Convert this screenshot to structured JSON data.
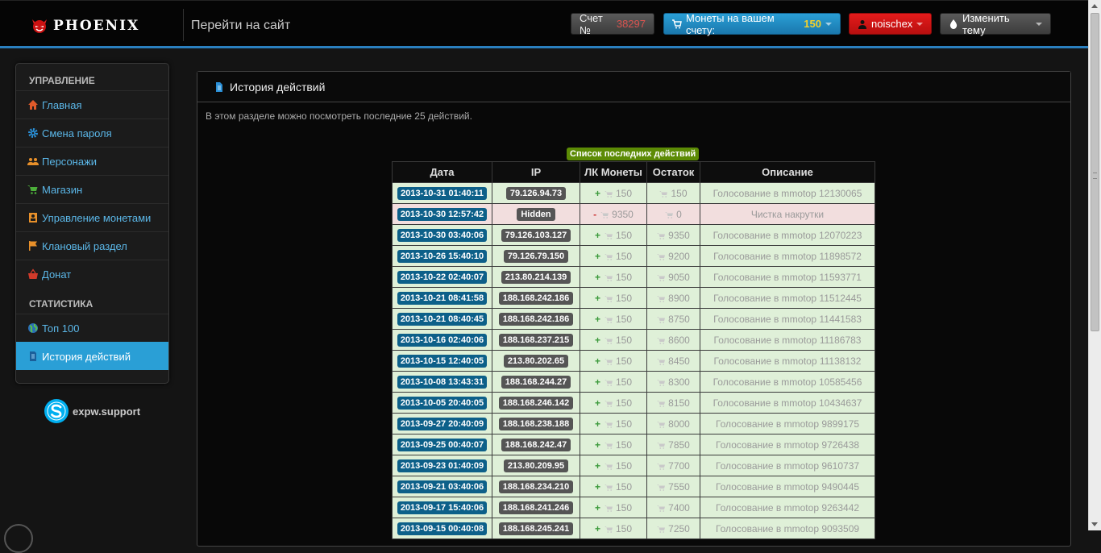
{
  "header": {
    "brand": "PHOENIX",
    "goto_site": "Перейти на сайт",
    "account_label": "Счет №",
    "account_number": "38297",
    "coins_label": "Монеты на вашем счету:",
    "coins_value": "150",
    "username": "noischex",
    "theme_label": "Изменить тему"
  },
  "sidebar": {
    "section_manage": "УПРАВЛЕНИЕ",
    "items": [
      {
        "label": "Главная",
        "icon": "home-icon"
      },
      {
        "label": "Смена пароля",
        "icon": "gear-icon"
      },
      {
        "label": "Персонажи",
        "icon": "users-icon"
      },
      {
        "label": "Магазин",
        "icon": "cart-icon"
      },
      {
        "label": "Управление монетами",
        "icon": "coins-icon"
      },
      {
        "label": "Клановый раздел",
        "icon": "flag-icon"
      },
      {
        "label": "Донат",
        "icon": "basket-icon"
      }
    ],
    "section_stats": "СТАТИСТИКА",
    "stats_items": [
      {
        "label": "Топ 100",
        "icon": "globe-icon"
      },
      {
        "label": "История действий",
        "icon": "document-icon",
        "active": true
      }
    ],
    "skype": "expw.support"
  },
  "panel": {
    "title": "История действий",
    "description": "В этом разделе можно посмотреть последние 25 действий."
  },
  "table": {
    "caption": "Список последних действий",
    "headers": [
      "Дата",
      "IP",
      "ЛК Монеты",
      "Остаток",
      "Описание"
    ],
    "rows": [
      {
        "date": "2013-10-31 01:40:11",
        "ip": "79.126.94.73",
        "sign": "+",
        "amount": "150",
        "balance": "150",
        "desc": "Голосование в mmotop 12130065",
        "type": "plus"
      },
      {
        "date": "2013-10-30 12:57:42",
        "ip": "Hidden",
        "sign": "-",
        "amount": "9350",
        "balance": "0",
        "desc": "Чистка накрутки",
        "type": "minus"
      },
      {
        "date": "2013-10-30 03:40:06",
        "ip": "79.126.103.127",
        "sign": "+",
        "amount": "150",
        "balance": "9350",
        "desc": "Голосование в mmotop 12070223",
        "type": "plus"
      },
      {
        "date": "2013-10-26 15:40:10",
        "ip": "79.126.79.150",
        "sign": "+",
        "amount": "150",
        "balance": "9200",
        "desc": "Голосование в mmotop 11898572",
        "type": "plus"
      },
      {
        "date": "2013-10-22 02:40:07",
        "ip": "213.80.214.139",
        "sign": "+",
        "amount": "150",
        "balance": "9050",
        "desc": "Голосование в mmotop 11593771",
        "type": "plus"
      },
      {
        "date": "2013-10-21 08:41:58",
        "ip": "188.168.242.186",
        "sign": "+",
        "amount": "150",
        "balance": "8900",
        "desc": "Голосование в mmotop 11512445",
        "type": "plus"
      },
      {
        "date": "2013-10-21 08:40:45",
        "ip": "188.168.242.186",
        "sign": "+",
        "amount": "150",
        "balance": "8750",
        "desc": "Голосование в mmotop 11441583",
        "type": "plus"
      },
      {
        "date": "2013-10-16 02:40:06",
        "ip": "188.168.237.215",
        "sign": "+",
        "amount": "150",
        "balance": "8600",
        "desc": "Голосование в mmotop 11186783",
        "type": "plus"
      },
      {
        "date": "2013-10-15 12:40:05",
        "ip": "213.80.202.65",
        "sign": "+",
        "amount": "150",
        "balance": "8450",
        "desc": "Голосование в mmotop 11138132",
        "type": "plus"
      },
      {
        "date": "2013-10-08 13:43:31",
        "ip": "188.168.244.27",
        "sign": "+",
        "amount": "150",
        "balance": "8300",
        "desc": "Голосование в mmotop 10585456",
        "type": "plus"
      },
      {
        "date": "2013-10-05 20:40:05",
        "ip": "188.168.246.142",
        "sign": "+",
        "amount": "150",
        "balance": "8150",
        "desc": "Голосование в mmotop 10434637",
        "type": "plus"
      },
      {
        "date": "2013-09-27 20:40:09",
        "ip": "188.168.238.188",
        "sign": "+",
        "amount": "150",
        "balance": "8000",
        "desc": "Голосование в mmotop 9899175",
        "type": "plus"
      },
      {
        "date": "2013-09-25 00:40:07",
        "ip": "188.168.242.47",
        "sign": "+",
        "amount": "150",
        "balance": "7850",
        "desc": "Голосование в mmotop 9726438",
        "type": "plus"
      },
      {
        "date": "2013-09-23 01:40:09",
        "ip": "213.80.209.95",
        "sign": "+",
        "amount": "150",
        "balance": "7700",
        "desc": "Голосование в mmotop 9610737",
        "type": "plus"
      },
      {
        "date": "2013-09-21 03:40:06",
        "ip": "188.168.234.210",
        "sign": "+",
        "amount": "150",
        "balance": "7550",
        "desc": "Голосование в mmotop 9490445",
        "type": "plus"
      },
      {
        "date": "2013-09-17 15:40:06",
        "ip": "188.168.241.246",
        "sign": "+",
        "amount": "150",
        "balance": "7400",
        "desc": "Голосование в mmotop 9263442",
        "type": "plus"
      },
      {
        "date": "2013-09-15 00:40:08",
        "ip": "188.168.245.241",
        "sign": "+",
        "amount": "150",
        "balance": "7250",
        "desc": "Голосование в mmotop 9093509",
        "type": "plus"
      }
    ]
  }
}
